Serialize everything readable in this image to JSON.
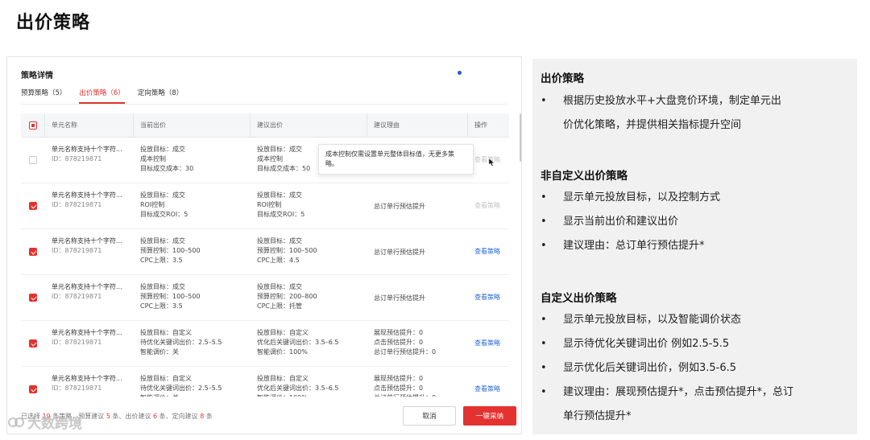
{
  "page_title": "出价策略",
  "panel": {
    "title": "策略详情",
    "tabs": [
      {
        "label": "预算策略（5）",
        "active": false
      },
      {
        "label": "出价策略（6）",
        "active": true
      },
      {
        "label": "定向策略（8）",
        "active": false
      }
    ],
    "columns": [
      "单元名称",
      "当前出价",
      "建议出价",
      "建议理由",
      "操作"
    ],
    "rows": [
      {
        "name": "单元名称支持十个字符...",
        "id": "ID：878219871",
        "checked": false,
        "current": [
          "投放目标：成交",
          "成本控制",
          "目标成交成本：30"
        ],
        "suggested": [
          "投放目标：成交",
          "成本控制",
          "目标成交成本：50"
        ],
        "reason": [],
        "op": "查看策略",
        "op_enabled": false
      },
      {
        "name": "单元名称支持十个字符...",
        "id": "ID：878219871",
        "checked": true,
        "current": [
          "投放目标：成交",
          "ROI控制",
          "目标成交ROI：5"
        ],
        "suggested": [
          "投放目标：成交",
          "ROI控制",
          "目标成交ROI：5"
        ],
        "reason": [
          "总订单行预估提升"
        ],
        "op": "查看策略",
        "op_enabled": false
      },
      {
        "name": "单元名称支持十个字符...",
        "id": "ID：878219871",
        "checked": true,
        "current": [
          "投放目标：成交",
          "预算控制：100–500",
          "CPC上限：3.5"
        ],
        "suggested": [
          "投放目标：成交",
          "预算控制：100–500",
          "CPC上限：4.5"
        ],
        "reason": [
          "总订单行预估提升"
        ],
        "op": "查看策略",
        "op_enabled": true
      },
      {
        "name": "单元名称支持十个字符...",
        "id": "ID：878219871",
        "checked": true,
        "current": [
          "投放目标：成交",
          "预算控制：100–500",
          "CPC上限：3.5"
        ],
        "suggested": [
          "投放目标：成交",
          "预算控制：200–800",
          "CPC上限：托管"
        ],
        "reason": [
          "总订单行预估提升"
        ],
        "op": "查看策略",
        "op_enabled": true
      },
      {
        "name": "单元名称支持十个字符...",
        "id": "ID：878219871",
        "checked": true,
        "current": [
          "投放目标：自定义",
          "待优化关键词出价：2.5–5.5",
          "智能调价：关"
        ],
        "suggested": [
          "投放目标：自定义",
          "优化后关键词出价：3.5–6.5",
          "智能调价：100%"
        ],
        "reason": [
          "展现预估提升：0",
          "点击预估提升：0",
          "总订单行预估提升：0"
        ],
        "op": "查看策略",
        "op_enabled": true
      },
      {
        "name": "单元名称支持十个字符...",
        "id": "ID：878219871",
        "checked": true,
        "current": [
          "投放目标：自定义",
          "待优化关键词出价：2.5–5.5",
          "智能调价：关"
        ],
        "suggested": [
          "投放目标：自定义",
          "优化后关键词出价：3.5–6.5",
          "智能调价：100%"
        ],
        "reason": [
          "展现预估提升：0",
          "点击预估提升：0",
          "总订单行预估提升：0"
        ],
        "op": "查看策略",
        "op_enabled": true
      }
    ],
    "tooltip": "成本控制仅需设置单元整体目标值，无更多策略。",
    "footer": {
      "prefix": "已选择 ",
      "count_total": "19",
      "mid1": " 条策略，预算建议 ",
      "count_budget": "5",
      "mid2": " 条、出价建议 ",
      "count_bid": "6",
      "mid3": " 条、定向建议 ",
      "count_target": "8",
      "suffix": " 条"
    },
    "cancel_label": "取消",
    "adopt_label": "一键采纳"
  },
  "watermark": "大数跨境",
  "right": {
    "sections": [
      {
        "heading": "出价策略",
        "items": [
          "根据历史投放水平+大盘竞价环境，制定单元出",
          "价优化策略，并提供相关指标提升空间"
        ]
      },
      {
        "heading": "非自定义出价策略",
        "items": [
          "显示单元投放目标，以及控制方式",
          "显示当前出价和建议出价",
          "建议理由：总订单行预估提升*"
        ]
      },
      {
        "heading": "自定义出价策略",
        "items": [
          "显示单元投放目标，以及智能调价状态",
          "显示待优化关键词出价 例如2.5-5.5",
          "显示优化后关键词出价，例如3.5-6.5",
          "建议理由：展现预估提升*，点击预估提升*，总订",
          "单行预估提升*"
        ]
      }
    ]
  },
  "colors": {
    "accent": "#e3322f",
    "link": "#2b6ad8"
  }
}
